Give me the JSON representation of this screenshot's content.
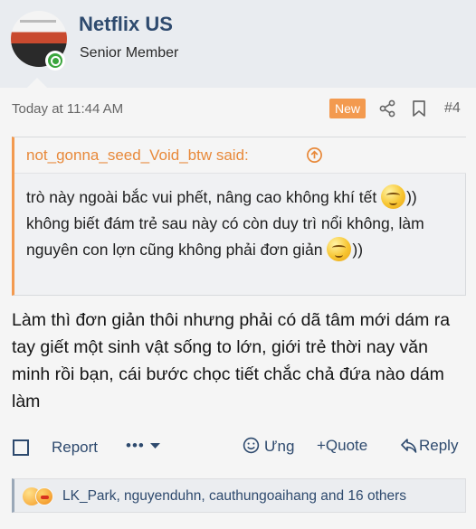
{
  "user": {
    "name": "Netflix US",
    "title": "Senior Member"
  },
  "post": {
    "timestamp": "Today at 11:44 AM",
    "badge": "New",
    "number": "#4"
  },
  "quote": {
    "author": "not_gonna_seed_Void_btw said:",
    "text_part1": "trò này ngoài bắc vui phết, nâng cao không khí tết ",
    "text_part2": ")) không biết đám trẻ sau này có còn duy trì nổi không, làm nguyên con lợn cũng không phải đơn giản ",
    "text_part3": "))"
  },
  "reply": {
    "text": "Làm thì đơn giản thôi nhưng phải có dã tâm mới dám ra tay giết một sinh vật sống to lớn, giới trẻ thời nay văn minh rồi bạn, cái bước chọc tiết chắc chả đứa nào dám làm"
  },
  "actions": {
    "report": "Report",
    "more": "•••",
    "react": "Ưng",
    "quote": "+Quote",
    "reply": "Reply"
  },
  "reactions": {
    "summary": "LK_Park, nguyenduhn, cauthungoaihang and 16 others"
  },
  "colors": {
    "accent": "#f39a4f",
    "link": "#2e4a6e",
    "online": "#3aa53c"
  }
}
